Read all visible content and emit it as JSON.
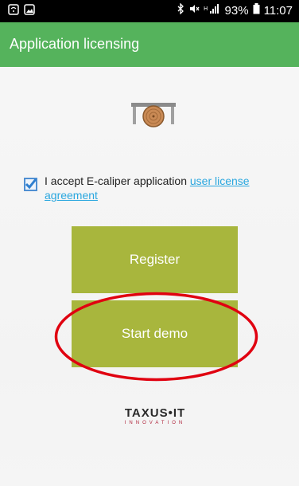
{
  "status_bar": {
    "battery": "93%",
    "time": "11:07"
  },
  "app_bar": {
    "title": "Application licensing"
  },
  "license": {
    "checked": true,
    "accept_text": "I accept E-caliper application ",
    "link_text": "user license agreement"
  },
  "buttons": {
    "register": "Register",
    "start_demo": "Start demo"
  },
  "company": {
    "name": "TAXUS•IT",
    "tagline": "INNOVATION"
  },
  "colors": {
    "app_bar": "#55b35c",
    "button": "#a8b63d",
    "link": "#2aa7df",
    "highlight": "#e00010"
  }
}
